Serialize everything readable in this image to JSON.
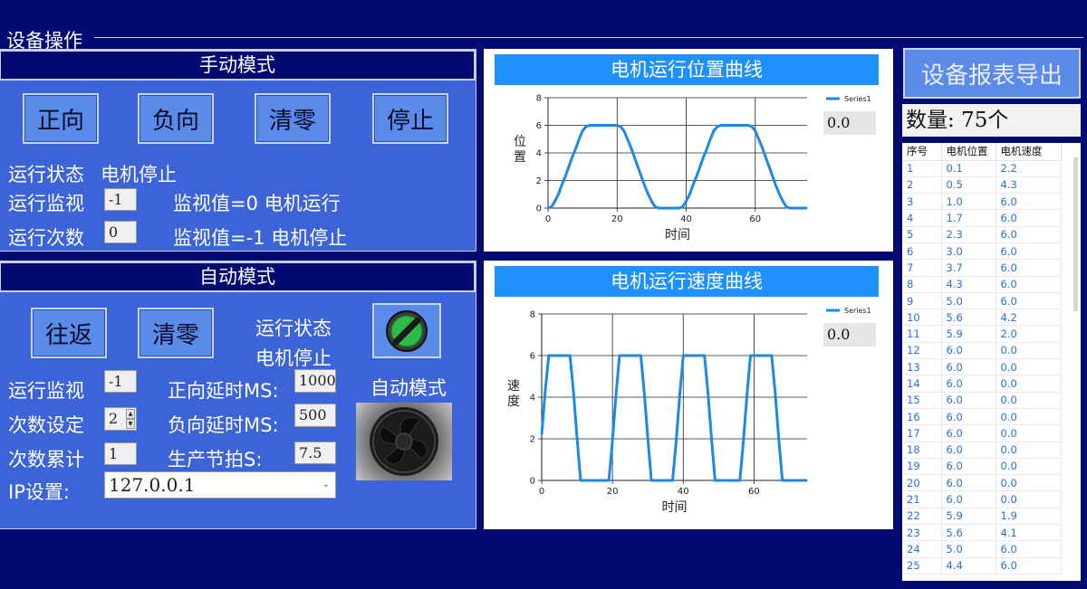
{
  "header": {
    "title": "设备操作"
  },
  "manual": {
    "title": "手动模式",
    "buttons": {
      "forward": "正向",
      "reverse": "负向",
      "clear": "清零",
      "stop": "停止"
    },
    "status_label": "运行状态",
    "status_value": "电机停止",
    "monitor_label": "运行监视",
    "monitor_value": "-1",
    "monitor_hint": "监视值=0  电机运行",
    "count_label": "运行次数",
    "count_value": "0",
    "count_hint": "监视值=-1 电机停止"
  },
  "auto": {
    "title": "自动模式",
    "buttons": {
      "roundtrip": "往返",
      "clear": "清零"
    },
    "status_label": "运行状态",
    "status_value": "电机停止",
    "monitor_label": "运行监视",
    "monitor_value": "-1",
    "fwd_delay_label": "正向延时MS:",
    "fwd_delay_value": "1000",
    "mode_label": "自动模式",
    "count_set_label": "次数设定",
    "count_set_value": "2",
    "rev_delay_label": "负向延时MS:",
    "rev_delay_value": "500",
    "count_total_label": "次数累计",
    "count_total_value": "1",
    "cycle_label": "生产节拍S:",
    "cycle_value": "7.5",
    "ip_label": "IP设置:",
    "ip_value": "127.0.0.1"
  },
  "export": {
    "button": "设备报表导出",
    "count_text": "数量: 75个"
  },
  "table": {
    "headers": [
      "序号",
      "电机位置",
      "电机速度"
    ],
    "rows": [
      [
        "1",
        "0.1",
        "2.2"
      ],
      [
        "2",
        "0.5",
        "4.3"
      ],
      [
        "3",
        "1.0",
        "6.0"
      ],
      [
        "4",
        "1.7",
        "6.0"
      ],
      [
        "5",
        "2.3",
        "6.0"
      ],
      [
        "6",
        "3.0",
        "6.0"
      ],
      [
        "7",
        "3.7",
        "6.0"
      ],
      [
        "8",
        "4.3",
        "6.0"
      ],
      [
        "9",
        "5.0",
        "6.0"
      ],
      [
        "10",
        "5.6",
        "4.2"
      ],
      [
        "11",
        "5.9",
        "2.0"
      ],
      [
        "12",
        "6.0",
        "0.0"
      ],
      [
        "13",
        "6.0",
        "0.0"
      ],
      [
        "14",
        "6.0",
        "0.0"
      ],
      [
        "15",
        "6.0",
        "0.0"
      ],
      [
        "16",
        "6.0",
        "0.0"
      ],
      [
        "17",
        "6.0",
        "0.0"
      ],
      [
        "18",
        "6.0",
        "0.0"
      ],
      [
        "19",
        "6.0",
        "0.0"
      ],
      [
        "20",
        "6.0",
        "0.0"
      ],
      [
        "21",
        "6.0",
        "0.0"
      ],
      [
        "22",
        "5.9",
        "1.9"
      ],
      [
        "23",
        "5.6",
        "4.1"
      ],
      [
        "24",
        "5.0",
        "6.0"
      ],
      [
        "25",
        "4.4",
        "6.0"
      ]
    ]
  },
  "colors": {
    "background": "#030a72",
    "panel": "#3c64d8",
    "button": "#5b8be8",
    "chart_line": "#1e88e5",
    "chart_title": "#1e90ff"
  },
  "chart_data": [
    {
      "type": "line",
      "title": "电机运行位置曲线",
      "xlabel": "时间",
      "ylabel": "位置",
      "legend": "top-right",
      "readout": "0.0",
      "xlim": [
        0,
        75
      ],
      "ylim": [
        0,
        8
      ],
      "xticks": [
        "0",
        "20",
        "40",
        "60"
      ],
      "yticks": [
        "0",
        "2",
        "4",
        "6",
        "8"
      ],
      "grid": true,
      "series": [
        {
          "name": "Series1",
          "x": [
            0,
            1,
            2,
            3,
            4,
            5,
            6,
            7,
            8,
            9,
            10,
            11,
            12,
            13,
            14,
            15,
            16,
            17,
            18,
            19,
            20,
            21,
            22,
            23,
            24,
            25,
            26,
            27,
            28,
            29,
            30,
            31,
            32,
            33,
            34,
            35,
            36,
            37,
            38,
            39,
            40,
            41,
            42,
            43,
            44,
            45,
            46,
            47,
            48,
            49,
            50,
            51,
            52,
            53,
            54,
            55,
            56,
            57,
            58,
            59,
            60,
            61,
            62,
            63,
            64,
            65,
            66,
            67,
            68,
            69,
            70,
            71,
            72,
            73,
            74,
            75
          ],
          "y": [
            0,
            0.1,
            0.5,
            1.0,
            1.7,
            2.3,
            3.0,
            3.7,
            4.3,
            5.0,
            5.6,
            5.9,
            6.0,
            6.0,
            6.0,
            6.0,
            6.0,
            6.0,
            6.0,
            6.0,
            6.0,
            5.9,
            5.6,
            5.0,
            4.4,
            3.7,
            3.0,
            2.3,
            1.6,
            1.0,
            0.5,
            0.1,
            0.0,
            0.0,
            0.0,
            0.0,
            0.0,
            0.0,
            0.0,
            0.1,
            0.5,
            1.0,
            1.7,
            2.3,
            3.0,
            3.7,
            4.3,
            5.0,
            5.6,
            5.9,
            6.0,
            6.0,
            6.0,
            6.0,
            6.0,
            6.0,
            6.0,
            6.0,
            6.0,
            5.9,
            5.6,
            5.0,
            4.4,
            3.7,
            3.0,
            2.3,
            1.6,
            1.0,
            0.5,
            0.1,
            0.0,
            0.0,
            0.0,
            0.0,
            0.0,
            0.0
          ]
        }
      ]
    },
    {
      "type": "line",
      "title": "电机运行速度曲线",
      "xlabel": "时间",
      "ylabel": "速度",
      "legend": "top-right",
      "readout": "0.0",
      "xlim": [
        0,
        75
      ],
      "ylim": [
        0,
        8
      ],
      "xticks": [
        "0",
        "20",
        "40",
        "60"
      ],
      "yticks": [
        "0",
        "2",
        "4",
        "6",
        "8"
      ],
      "grid": true,
      "series": [
        {
          "name": "Series1",
          "x": [
            0,
            1,
            2,
            3,
            4,
            5,
            6,
            7,
            8,
            9,
            10,
            11,
            12,
            13,
            14,
            15,
            16,
            17,
            18,
            19,
            20,
            21,
            22,
            23,
            24,
            25,
            26,
            27,
            28,
            29,
            30,
            31,
            32,
            33,
            34,
            35,
            36,
            37,
            38,
            39,
            40,
            41,
            42,
            43,
            44,
            45,
            46,
            47,
            48,
            49,
            50,
            51,
            52,
            53,
            54,
            55,
            56,
            57,
            58,
            59,
            60,
            61,
            62,
            63,
            64,
            65,
            66,
            67,
            68,
            69,
            70,
            71,
            72,
            73,
            74,
            75
          ],
          "y": [
            2.2,
            4.3,
            6.0,
            6.0,
            6.0,
            6.0,
            6.0,
            6.0,
            6.0,
            4.2,
            2.0,
            0.0,
            0.0,
            0.0,
            0.0,
            0.0,
            0.0,
            0.0,
            0.0,
            0.0,
            1.9,
            4.1,
            6.0,
            6.0,
            6.0,
            6.0,
            6.0,
            6.0,
            6.0,
            4.2,
            2.0,
            0.0,
            0.0,
            0.0,
            0.0,
            0.0,
            0.0,
            0.0,
            1.9,
            4.1,
            6.0,
            6.0,
            6.0,
            6.0,
            6.0,
            6.0,
            6.0,
            4.2,
            2.0,
            0.0,
            0.0,
            0.0,
            0.0,
            0.0,
            0.0,
            0.0,
            0.0,
            1.9,
            4.1,
            6.0,
            6.0,
            6.0,
            6.0,
            6.0,
            6.0,
            6.0,
            4.2,
            2.0,
            0.0,
            0.0,
            0.0,
            0.0,
            0.0,
            0.0,
            0.0,
            0.0
          ]
        }
      ]
    }
  ]
}
